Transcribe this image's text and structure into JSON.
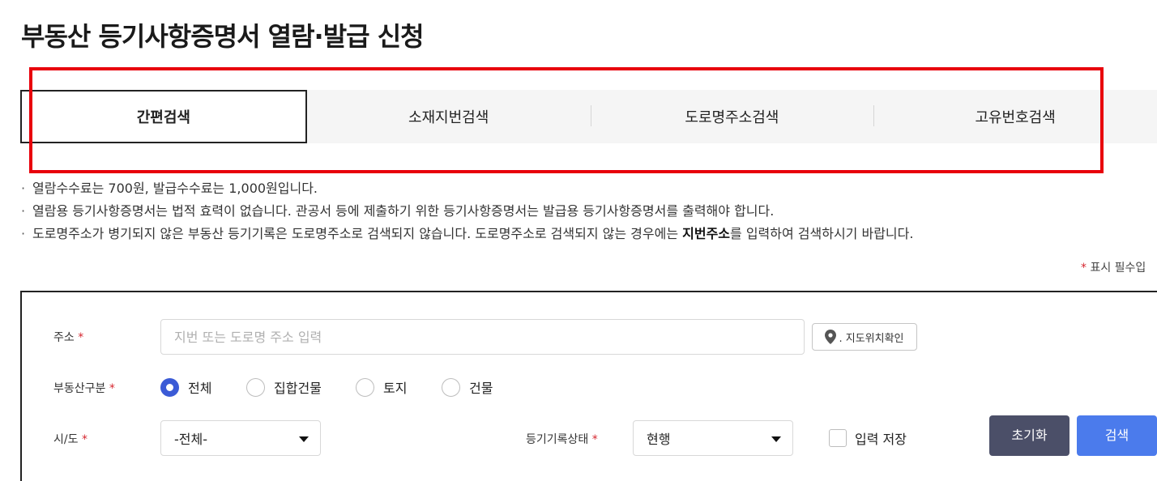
{
  "page": {
    "title": "부동산 등기사항증명서 열람·발급 신청"
  },
  "tabs": [
    {
      "label": "간편검색",
      "active": true
    },
    {
      "label": "소재지번검색",
      "active": false
    },
    {
      "label": "도로명주소검색",
      "active": false
    },
    {
      "label": "고유번호검색",
      "active": false
    }
  ],
  "notes": {
    "bullet": "·",
    "line1": "열람수수료는  700원, 발급수수료는  1,000원입니다.",
    "line2": "열람용 등기사항증명서는 법적 효력이 없습니다. 관공서 등에 제출하기 위한 등기사항증명서는 발급용 등기사항증명서를 출력해야 합니다.",
    "line3_pre": "도로명주소가 병기되지 않은 부동산 등기기록은 도로명주소로 검색되지 않습니다. 도로명주소로 검색되지 않는 경우에는 ",
    "line3_bold": "지번주소",
    "line3_post": "를 입력하여 검색하시기 바랍니다."
  },
  "required_note": {
    "star": "*",
    "text": "표시 필수입"
  },
  "form": {
    "required_mark": "*",
    "address": {
      "label": "주소",
      "placeholder": "지번 또는 도로명 주소 입력",
      "value": ""
    },
    "map_button": {
      "label": ". 지도위치확인",
      "icon": "map-pin-icon"
    },
    "property_type": {
      "label": "부동산구분",
      "options": [
        "전체",
        "집합건물",
        "토지",
        "건물"
      ],
      "selected": "전체"
    },
    "sido": {
      "label": "시/도",
      "value": "-전체-"
    },
    "record_status": {
      "label": "등기기록상태",
      "value": "현행"
    },
    "save_input": {
      "label": "입력 저장",
      "checked": false
    },
    "reset_button": "초기화",
    "search_button": "검색"
  },
  "colors": {
    "highlight": "#e8000b",
    "primary": "#4b7bec",
    "reset": "#4b4f68",
    "required": "#d6262f",
    "radio_checked": "#3b5bd6"
  }
}
